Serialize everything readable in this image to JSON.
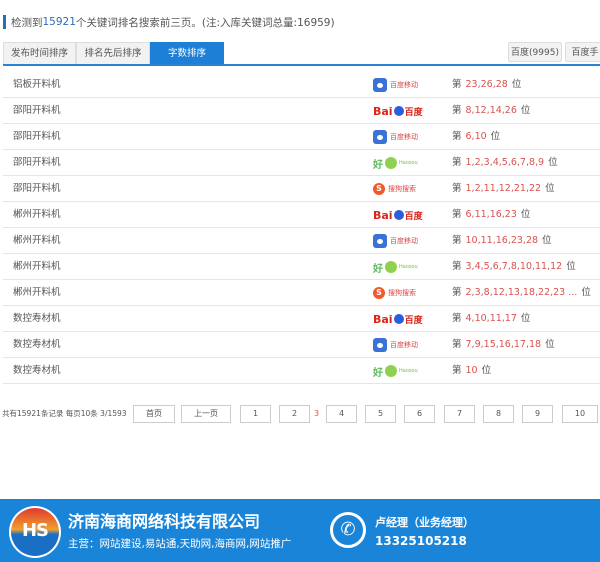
{
  "summary": {
    "prefix": "检测到",
    "count": "15921",
    "suffix": "个关键词排名搜索前三页。(注:入库关键词总量:16959)"
  },
  "tabs": [
    {
      "label": "发布时间排序"
    },
    {
      "label": "排名先后排序"
    },
    {
      "label": "字数排序"
    }
  ],
  "engine_buttons": [
    {
      "label": "百度(9995)"
    },
    {
      "label": "百度手"
    }
  ],
  "engines": {
    "baidu_mobile": {
      "name": "百度移动"
    },
    "baidu": {
      "bai": "Bai",
      "du": "百度"
    },
    "haosou": {
      "name": "好",
      "sub": "Haosou"
    },
    "sogou": {
      "name": "搜狗搜索",
      "glyph": "S"
    }
  },
  "rank_prefix": "第",
  "rank_suffix": "位",
  "rows": [
    {
      "keyword": "铝板开料机",
      "engine": "baidu_mobile",
      "ranks": "23,26,28"
    },
    {
      "keyword": "邵阳开料机",
      "engine": "baidu",
      "ranks": "8,12,14,26"
    },
    {
      "keyword": "邵阳开料机",
      "engine": "baidu_mobile",
      "ranks": "6,10"
    },
    {
      "keyword": "邵阳开料机",
      "engine": "haosou",
      "ranks": "1,2,3,4,5,6,7,8,9"
    },
    {
      "keyword": "邵阳开料机",
      "engine": "sogou",
      "ranks": "1,2,11,12,21,22"
    },
    {
      "keyword": "郴州开料机",
      "engine": "baidu",
      "ranks": "6,11,16,23"
    },
    {
      "keyword": "郴州开料机",
      "engine": "baidu_mobile",
      "ranks": "10,11,16,23,28"
    },
    {
      "keyword": "郴州开料机",
      "engine": "haosou",
      "ranks": "3,4,5,6,7,8,10,11,12"
    },
    {
      "keyword": "郴州开料机",
      "engine": "sogou",
      "ranks": "2,3,8,12,13,18,22,23 ..."
    },
    {
      "keyword": "数控寿材机",
      "engine": "baidu",
      "ranks": "4,10,11,17"
    },
    {
      "keyword": "数控寿材机",
      "engine": "baidu_mobile",
      "ranks": "7,9,15,16,17,18"
    },
    {
      "keyword": "数控寿材机",
      "engine": "haosou",
      "ranks": "10"
    }
  ],
  "pager": {
    "info": "共有15921条记录 每页10条 3/1593",
    "first": "首页",
    "prev": "上一页",
    "pages": [
      "1",
      "2"
    ],
    "current": "3",
    "more_pages": [
      "4",
      "5",
      "6",
      "7",
      "8",
      "9",
      "10"
    ]
  },
  "footer": {
    "logo_text": "HS",
    "company": "济南海商网络科技有限公司",
    "business": "主营：网站建设,易站通,天助网,海商网,网站推广",
    "phone_glyph": "✆",
    "contact": "卢经理（业务经理）",
    "tel": "13325105218"
  }
}
